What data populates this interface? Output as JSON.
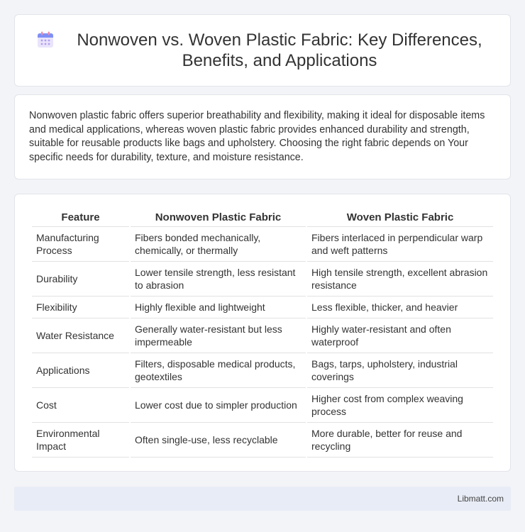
{
  "header": {
    "title": "Nonwoven vs. Woven Plastic Fabric: Key Differences, Benefits, and Applications",
    "icon": "calendar-icon"
  },
  "intro": "Nonwoven plastic fabric offers superior breathability and flexibility, making it ideal for disposable items and medical applications, whereas woven plastic fabric provides enhanced durability and strength, suitable for reusable products like bags and upholstery. Choosing the right fabric depends on Your specific needs for durability, texture, and moisture resistance.",
  "table": {
    "headers": [
      "Feature",
      "Nonwoven Plastic Fabric",
      "Woven Plastic Fabric"
    ],
    "rows": [
      [
        "Manufacturing Process",
        "Fibers bonded mechanically, chemically, or thermally",
        "Fibers interlaced in perpendicular warp and weft patterns"
      ],
      [
        "Durability",
        "Lower tensile strength, less resistant to abrasion",
        "High tensile strength, excellent abrasion resistance"
      ],
      [
        "Flexibility",
        "Highly flexible and lightweight",
        "Less flexible, thicker, and heavier"
      ],
      [
        "Water Resistance",
        "Generally water-resistant but less impermeable",
        "Highly water-resistant and often waterproof"
      ],
      [
        "Applications",
        "Filters, disposable medical products, geotextiles",
        "Bags, tarps, upholstery, industrial coverings"
      ],
      [
        "Cost",
        "Lower cost due to simpler production",
        "Higher cost from complex weaving process"
      ],
      [
        "Environmental Impact",
        "Often single-use, less recyclable",
        "More durable, better for reuse and recycling"
      ]
    ]
  },
  "footer": {
    "brand": "Libmatt.com"
  }
}
